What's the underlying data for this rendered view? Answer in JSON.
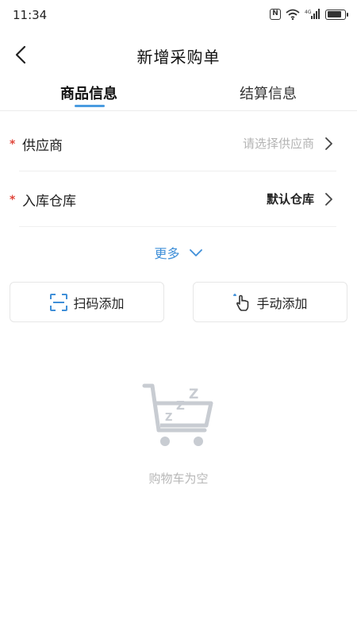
{
  "status_bar": {
    "time": "11:34",
    "icons": [
      "nfc-icon",
      "wifi-icon",
      "signal-icon",
      "battery-icon"
    ],
    "battery_level": 0.85
  },
  "nav": {
    "title": "新增采购单",
    "back_icon": "chevron-left-icon"
  },
  "tabs": [
    {
      "label": "商品信息",
      "active": true
    },
    {
      "label": "结算信息",
      "active": false
    }
  ],
  "form": {
    "supplier": {
      "label": "供应商",
      "required": "*",
      "placeholder": "请选择供应商"
    },
    "warehouse": {
      "label": "入库仓库",
      "required": "*",
      "value": "默认仓库"
    }
  },
  "more": {
    "label": "更多"
  },
  "actions": {
    "scan": {
      "label": "扫码添加",
      "icon": "scan-icon"
    },
    "manual": {
      "label": "手动添加",
      "icon": "hand-tap-icon"
    }
  },
  "empty_state": {
    "icon": "sleeping-cart-icon",
    "zzz": "Z Z Z",
    "text": "购物车为空"
  },
  "colors": {
    "accent": "#4a9be0",
    "link": "#3f8fd8",
    "required": "#e0453a",
    "placeholder": "#b4b4b4",
    "empty_icon": "#c8ccd2"
  }
}
